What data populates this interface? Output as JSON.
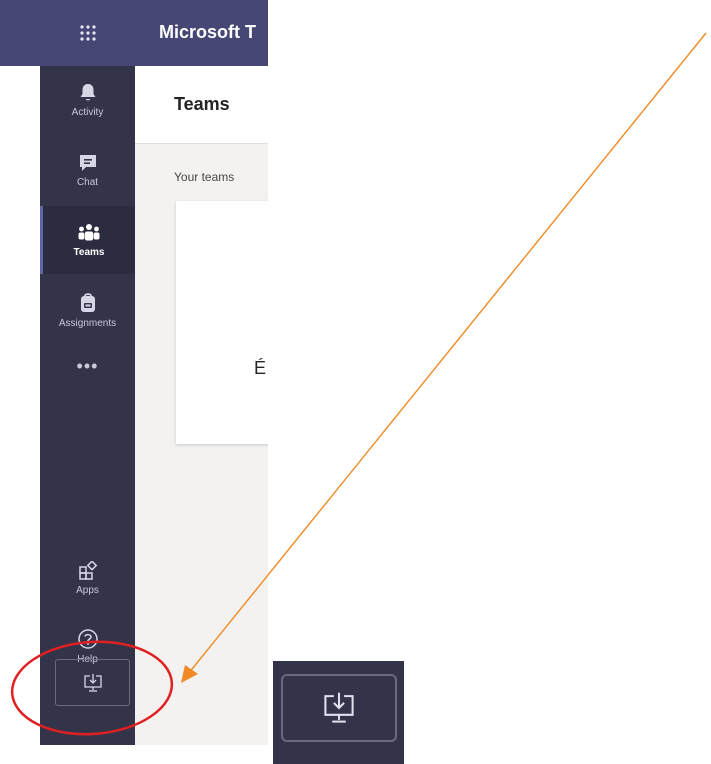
{
  "header": {
    "app_title": "Microsoft T"
  },
  "rail": {
    "items": [
      {
        "label": "Activity",
        "icon": "bell-icon"
      },
      {
        "label": "Chat",
        "icon": "chat-icon"
      },
      {
        "label": "Teams",
        "icon": "teams-icon",
        "active": true
      },
      {
        "label": "Assignments",
        "icon": "assignments-icon"
      }
    ],
    "more_label": "•••",
    "bottom_items": [
      {
        "label": "Apps",
        "icon": "apps-icon"
      },
      {
        "label": "Help",
        "icon": "help-icon"
      }
    ],
    "download_icon": "download-desktop-icon"
  },
  "content": {
    "title": "Teams",
    "section_label": "Your teams",
    "team_card": {
      "name": "É"
    }
  },
  "colors": {
    "app_bar": "#464775",
    "rail": "#33344a",
    "accent": "#6264a7",
    "annotation_arrow": "#f08a24",
    "annotation_circle": "#e02020"
  }
}
